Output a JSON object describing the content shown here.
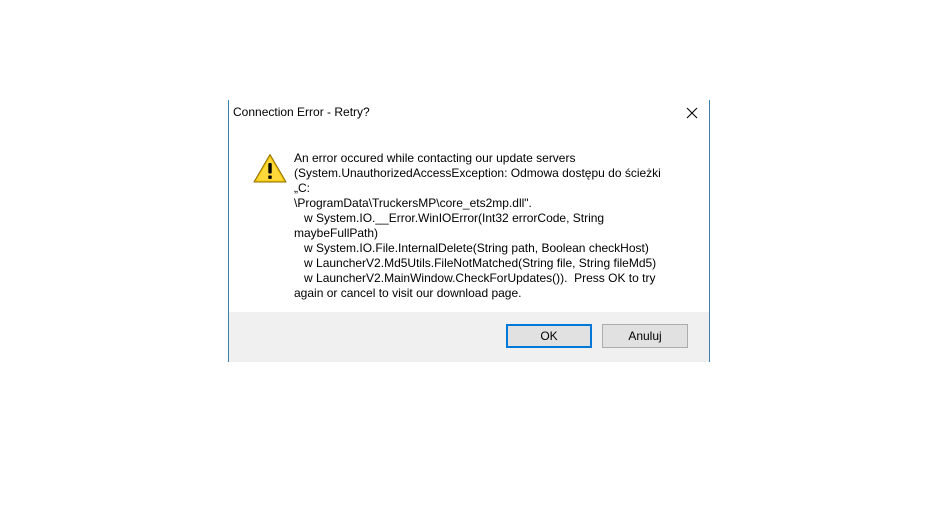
{
  "dialog": {
    "title": "Connection Error - Retry?",
    "message": "An error occured while contacting our update servers\n(System.UnauthorizedAccessException: Odmowa dostępu do ścieżki „C:\n\\ProgramData\\TruckersMP\\core_ets2mp.dll\".\n   w System.IO.__Error.WinIOError(Int32 errorCode, String\nmaybeFullPath)\n   w System.IO.File.InternalDelete(String path, Boolean checkHost)\n   w LauncherV2.Md5Utils.FileNotMatched(String file, String fileMd5)\n   w LauncherV2.MainWindow.CheckForUpdates()).  Press OK to try\nagain or cancel to visit our download page.",
    "icon": "warning-icon",
    "close_icon": "close-icon",
    "buttons": {
      "ok_label": "OK",
      "cancel_label": "Anuluj"
    }
  },
  "colors": {
    "window_border": "#3c7fb1",
    "footer_bg": "#f0f0f0",
    "default_button_border": "#0078d7",
    "warning_yellow": "#f5c400"
  }
}
